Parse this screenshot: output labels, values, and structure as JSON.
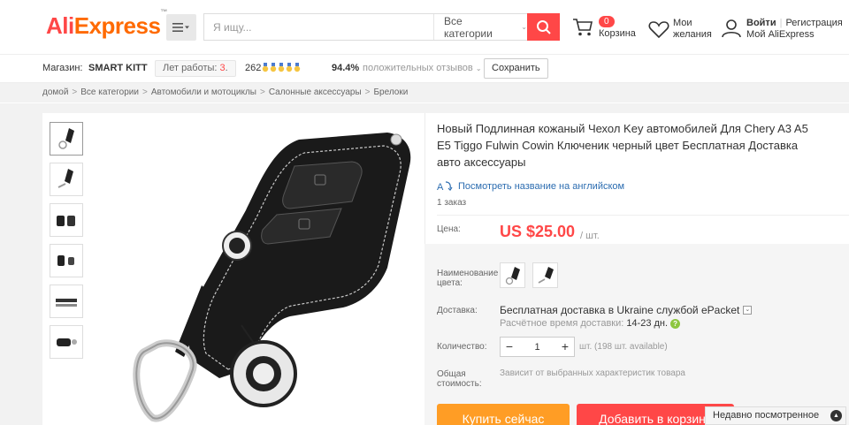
{
  "header": {
    "logo_ali": "Ali",
    "logo_express": "Express",
    "logo_tm": "™",
    "search_placeholder": "Я ищу...",
    "category_label": "Все категории",
    "cart_count": "0",
    "cart_label": "Корзина",
    "wishlist_label": "Мои желания",
    "signin_label": "Войти",
    "register_label": "Регистрация",
    "my_aliexpress_label": "Мой AliExpress"
  },
  "store": {
    "store_label": "Магазин:",
    "store_name": "SMART KITT",
    "years_label": "Лет работы:",
    "years_value": "3",
    "rating_number": "262",
    "positive_pct": "94.4%",
    "positive_label": "положительных отзывов",
    "save_label": "Сохранить"
  },
  "breadcrumb": [
    "домой",
    "Все категории",
    "Автомобили и мотоциклы",
    "Салонные аксессуары",
    "Брелоки"
  ],
  "product": {
    "title": "Новый Подлинная кожаный Чехол Key автомобилей Для Chery A3 A5 E5 Tiggo Fulwin Cowin Ключеник черный цвет Бесплатная Доставка авто аксессуары",
    "translate_label": "Посмотреть название на английском",
    "orders": "1 заказ",
    "price_label": "Цена:",
    "price": "US $25.00",
    "unit": "/ шт.",
    "color_label": "Наименование цвета:",
    "shipping_label": "Доставка:",
    "shipping_text": "Бесплатная доставка в Ukraine службой ePacket",
    "eta_label": "Расчётное время доставки:",
    "eta_days": "14-23 дн.",
    "quantity_label": "Количество:",
    "quantity_value": "1",
    "quantity_available": "шт. (198 шт. available)",
    "total_label": "Общая стоимость:",
    "total_text": "Зависит от выбранных характеристик товара",
    "buy_now": "Купить сейчас",
    "add_to_cart": "Добавить в корзину"
  },
  "recently_viewed": "Недавно посмотренное",
  "colors": {
    "brand_red": "#ff4747",
    "brand_orange": "#ff6a00",
    "buy_orange": "#ff9d25"
  }
}
